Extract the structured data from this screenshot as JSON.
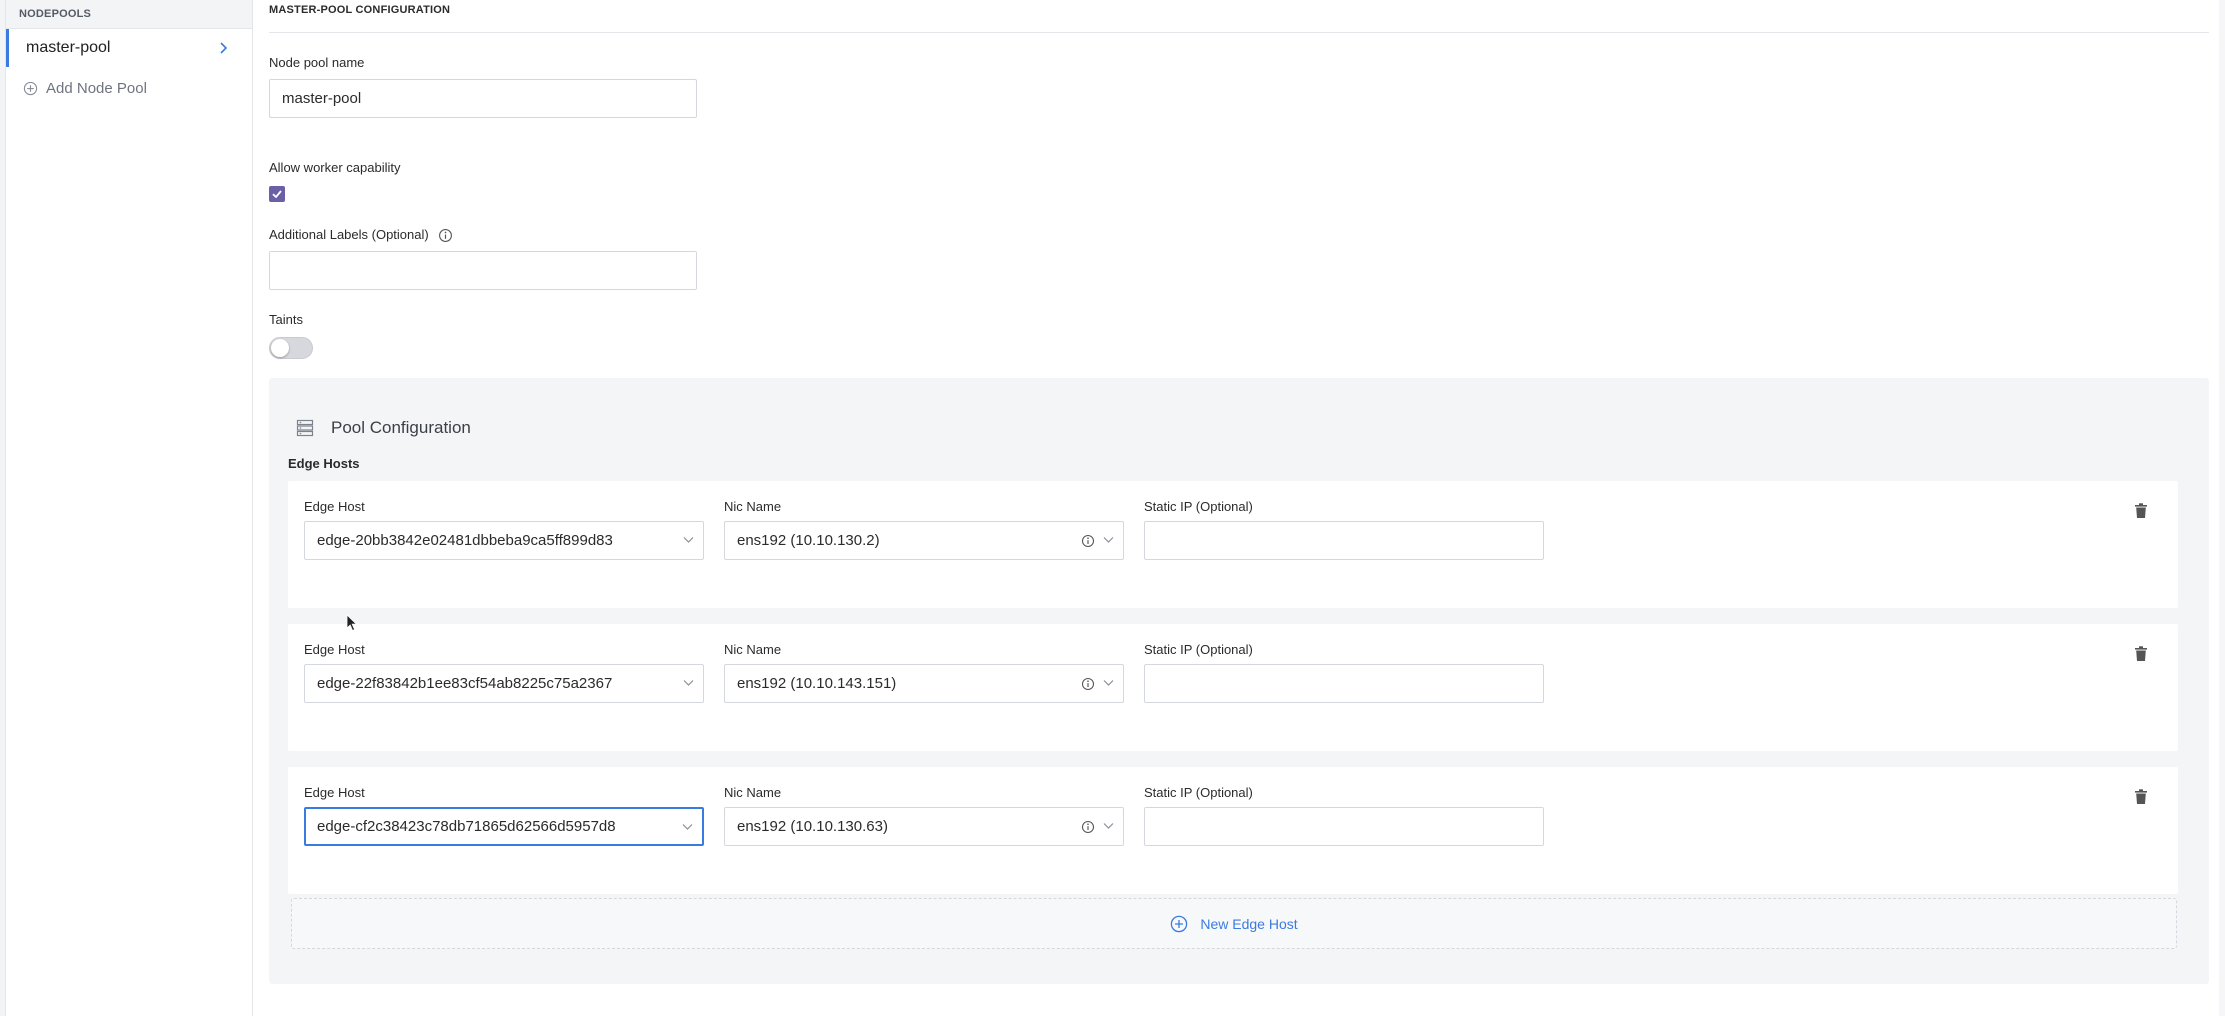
{
  "sidebar": {
    "header": "NODEPOOLS",
    "items": [
      {
        "label": "master-pool"
      }
    ],
    "add_label": "Add Node Pool"
  },
  "main": {
    "section_title": "MASTER-POOL CONFIGURATION",
    "node_pool_name": {
      "label": "Node pool name",
      "value": "master-pool"
    },
    "worker_capability": {
      "label": "Allow worker capability",
      "checked": true
    },
    "additional_labels": {
      "label": "Additional Labels (Optional)",
      "value": ""
    },
    "taints": {
      "label": "Taints",
      "enabled": false
    },
    "pool_config": {
      "title": "Pool Configuration",
      "edge_hosts_label": "Edge Hosts",
      "hosts": [
        {
          "edge_host_label": "Edge Host",
          "edge_host": "edge-20bb3842e02481dbbeba9ca5ff899d83",
          "nic_label": "Nic Name",
          "nic": "ens192 (10.10.130.2)",
          "static_ip_label": "Static IP (Optional)",
          "static_ip": ""
        },
        {
          "edge_host_label": "Edge Host",
          "edge_host": "edge-22f83842b1ee83cf54ab8225c75a2367",
          "nic_label": "Nic Name",
          "nic": "ens192 (10.10.143.151)",
          "static_ip_label": "Static IP (Optional)",
          "static_ip": ""
        },
        {
          "edge_host_label": "Edge Host",
          "edge_host": "edge-cf2c38423c78db71865d62566d5957d8",
          "nic_label": "Nic Name",
          "nic": "ens192 (10.10.130.63)",
          "static_ip_label": "Static IP (Optional)",
          "static_ip": ""
        }
      ],
      "new_host_label": "New Edge Host"
    }
  },
  "colors": {
    "accent": "#3a7be0",
    "checkbox": "#6b5fa6",
    "panel": "#f4f5f7"
  }
}
